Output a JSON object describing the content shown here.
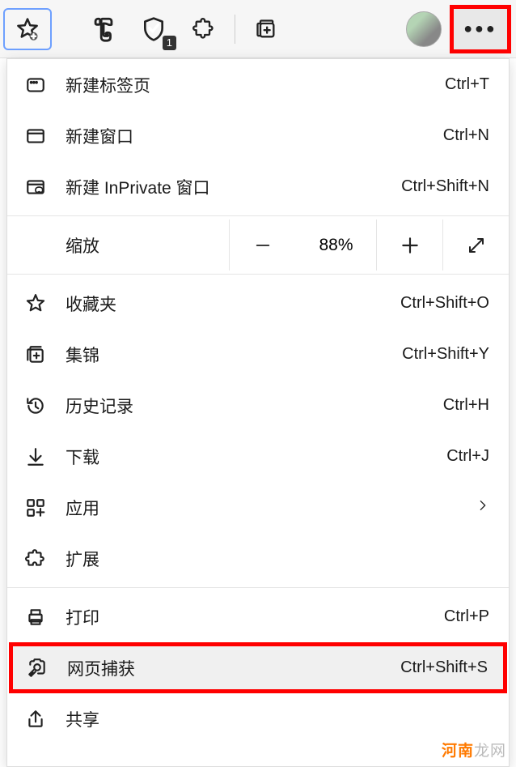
{
  "toolbar": {
    "extension_badge": "1"
  },
  "menu": {
    "new_tab": {
      "label": "新建标签页",
      "shortcut": "Ctrl+T"
    },
    "new_window": {
      "label": "新建窗口",
      "shortcut": "Ctrl+N"
    },
    "new_inprivate": {
      "label": "新建 InPrivate 窗口",
      "shortcut": "Ctrl+Shift+N"
    },
    "zoom": {
      "label": "缩放",
      "value": "88%"
    },
    "favorites": {
      "label": "收藏夹",
      "shortcut": "Ctrl+Shift+O"
    },
    "collections": {
      "label": "集锦",
      "shortcut": "Ctrl+Shift+Y"
    },
    "history": {
      "label": "历史记录",
      "shortcut": "Ctrl+H"
    },
    "downloads": {
      "label": "下载",
      "shortcut": "Ctrl+J"
    },
    "apps": {
      "label": "应用"
    },
    "extensions": {
      "label": "扩展"
    },
    "print": {
      "label": "打印",
      "shortcut": "Ctrl+P"
    },
    "capture": {
      "label": "网页捕获",
      "shortcut": "Ctrl+Shift+S"
    },
    "share": {
      "label": "共享"
    }
  },
  "watermark": {
    "prefix": "河南",
    "suffix": "龙网"
  }
}
